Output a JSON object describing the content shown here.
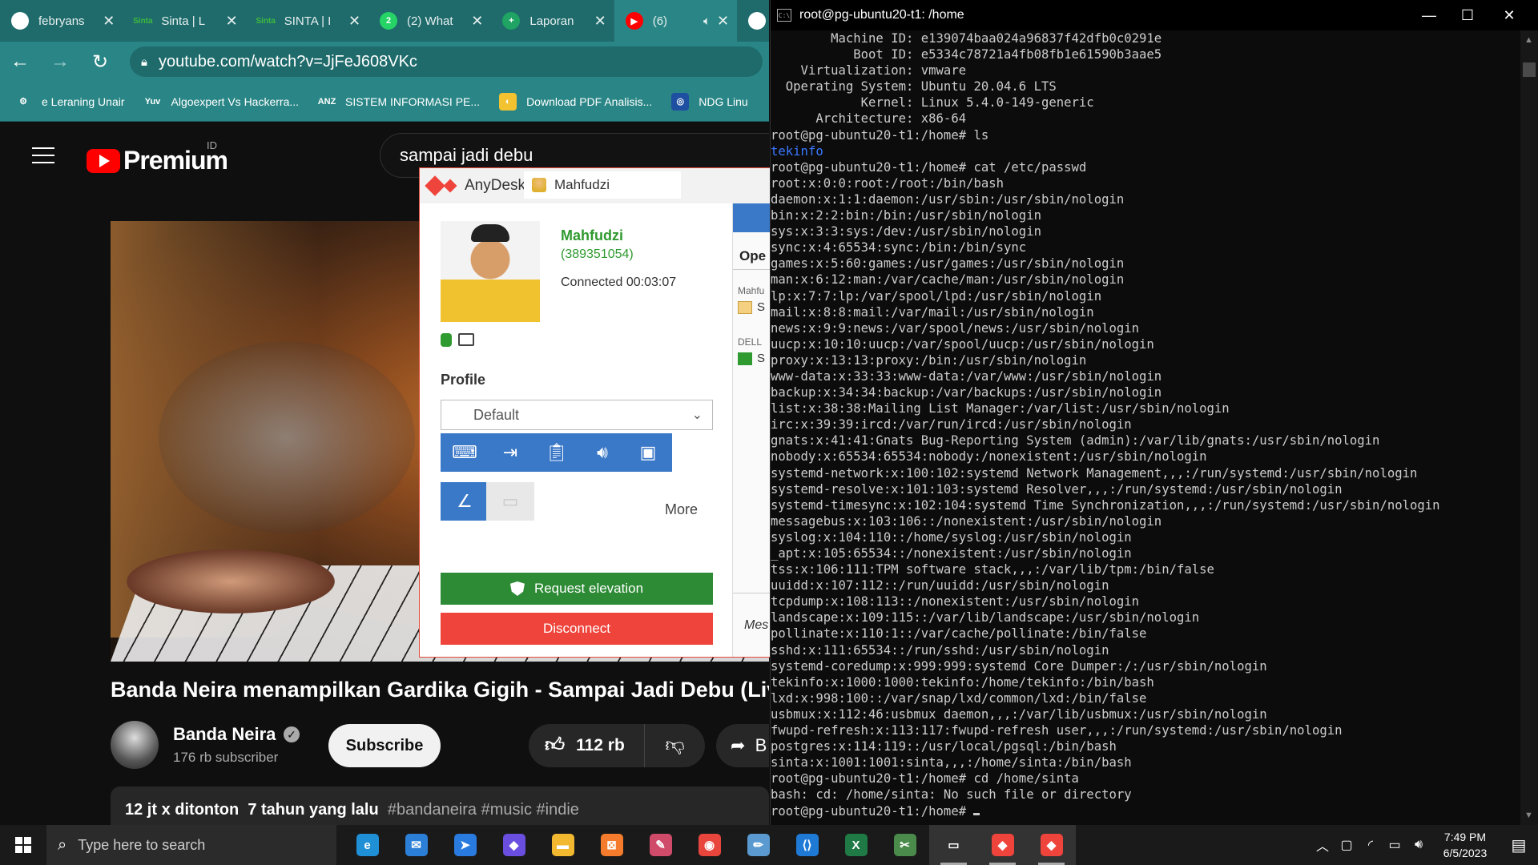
{
  "browser": {
    "tabs": [
      {
        "title": "febryans",
        "icon": "github-icon",
        "icon_text": "",
        "color": "#ffffff"
      },
      {
        "title": "Sinta | L",
        "icon": "sinta-icon",
        "icon_text": "Sinta",
        "color": "#3dbb3d"
      },
      {
        "title": "SINTA | I",
        "icon": "sinta-icon",
        "icon_text": "Sinta",
        "color": "#3dbb3d"
      },
      {
        "title": "(2) What",
        "icon": "whatsapp-icon",
        "icon_text": "2",
        "color": "#25d366"
      },
      {
        "title": "Laporan",
        "icon": "google-sheets-icon",
        "icon_text": "+",
        "color": "#1fa463"
      },
      {
        "title": "(6)",
        "icon": "youtube-icon",
        "icon_text": "▶",
        "color": "#ff0000"
      }
    ],
    "url": "youtube.com/watch?v=JjFeJ608VKc",
    "bookmarks": [
      {
        "label": "e Leraning Unair",
        "icon": "gear-icon",
        "icon_text": "⚙",
        "color": "#2a8686"
      },
      {
        "label": "Algoexpert Vs Hackerra...",
        "icon": "yuv-icon",
        "icon_text": "Yuv",
        "color": "#2a8686"
      },
      {
        "label": "SISTEM INFORMASI PE...",
        "icon": "anz-icon",
        "icon_text": "ANZ",
        "color": "#2a8686"
      },
      {
        "label": "Download PDF Analisis...",
        "icon": "pdf-icon",
        "icon_text": "◐",
        "color": "#f2c230"
      },
      {
        "label": "NDG Linu",
        "icon": "ndg-icon",
        "icon_text": "◎",
        "color": "#1e4fa0"
      }
    ]
  },
  "youtube": {
    "logo": "Premium",
    "country": "ID",
    "search_value": "sampai jadi debu",
    "title": "Banda Neira menampilkan Gardika Gigih - Sampai Jadi Debu (Live",
    "channel": "Banda Neira",
    "subscribers": "176 rb subscriber",
    "subscribe_label": "Subscribe",
    "likes": "112 rb",
    "share_label": "B",
    "views": "12 jt x ditonton",
    "age": "7 tahun yang lalu",
    "tags": "#bandaneira #music #indie"
  },
  "anydesk": {
    "app_name": "AnyDesk",
    "tab_name": "Mahfudzi",
    "user_name": "Mahfudzi",
    "user_id": "(389351054)",
    "connected": "Connected 00:03:07",
    "profile_label": "Profile",
    "profile_value": "Default",
    "tools": [
      "keyboard-mouse-icon",
      "file-transfer-icon",
      "clipboard-icon",
      "audio-icon",
      "record-icon",
      "draw-icon",
      "screen-lock-icon"
    ],
    "more_label": "More",
    "elevation_label": "Request elevation",
    "disconnect_label": "Disconnect",
    "side": {
      "open": "Ope",
      "sub1": "Mahfu",
      "item1": "S",
      "sub2": "DELL",
      "item2": "S",
      "mes": "Mes"
    }
  },
  "terminal": {
    "title": "root@pg-ubuntu20-t1: /home",
    "lines": [
      "        Machine ID: e139074baa024a96837f42dfb0c0291e",
      "           Boot ID: e5334c78721a4fb08fb1e61590b3aae5",
      "    Virtualization: vmware",
      "  Operating System: Ubuntu 20.04.6 LTS",
      "            Kernel: Linux 5.4.0-149-generic",
      "      Architecture: x86-64",
      "root@pg-ubuntu20-t1:/home# ls",
      "tekinfo",
      "root@pg-ubuntu20-t1:/home# cat /etc/passwd",
      "root:x:0:0:root:/root:/bin/bash",
      "daemon:x:1:1:daemon:/usr/sbin:/usr/sbin/nologin",
      "bin:x:2:2:bin:/bin:/usr/sbin/nologin",
      "sys:x:3:3:sys:/dev:/usr/sbin/nologin",
      "sync:x:4:65534:sync:/bin:/bin/sync",
      "games:x:5:60:games:/usr/games:/usr/sbin/nologin",
      "man:x:6:12:man:/var/cache/man:/usr/sbin/nologin",
      "lp:x:7:7:lp:/var/spool/lpd:/usr/sbin/nologin",
      "mail:x:8:8:mail:/var/mail:/usr/sbin/nologin",
      "news:x:9:9:news:/var/spool/news:/usr/sbin/nologin",
      "uucp:x:10:10:uucp:/var/spool/uucp:/usr/sbin/nologin",
      "proxy:x:13:13:proxy:/bin:/usr/sbin/nologin",
      "www-data:x:33:33:www-data:/var/www:/usr/sbin/nologin",
      "backup:x:34:34:backup:/var/backups:/usr/sbin/nologin",
      "list:x:38:38:Mailing List Manager:/var/list:/usr/sbin/nologin",
      "irc:x:39:39:ircd:/var/run/ircd:/usr/sbin/nologin",
      "gnats:x:41:41:Gnats Bug-Reporting System (admin):/var/lib/gnats:/usr/sbin/nologin",
      "nobody:x:65534:65534:nobody:/nonexistent:/usr/sbin/nologin",
      "systemd-network:x:100:102:systemd Network Management,,,:/run/systemd:/usr/sbin/nologin",
      "systemd-resolve:x:101:103:systemd Resolver,,,:/run/systemd:/usr/sbin/nologin",
      "systemd-timesync:x:102:104:systemd Time Synchronization,,,:/run/systemd:/usr/sbin/nologin",
      "messagebus:x:103:106::/nonexistent:/usr/sbin/nologin",
      "syslog:x:104:110::/home/syslog:/usr/sbin/nologin",
      "_apt:x:105:65534::/nonexistent:/usr/sbin/nologin",
      "tss:x:106:111:TPM software stack,,,:/var/lib/tpm:/bin/false",
      "uuidd:x:107:112::/run/uuidd:/usr/sbin/nologin",
      "tcpdump:x:108:113::/nonexistent:/usr/sbin/nologin",
      "landscape:x:109:115::/var/lib/landscape:/usr/sbin/nologin",
      "pollinate:x:110:1::/var/cache/pollinate:/bin/false",
      "sshd:x:111:65534::/run/sshd:/usr/sbin/nologin",
      "systemd-coredump:x:999:999:systemd Core Dumper:/:/usr/sbin/nologin",
      "tekinfo:x:1000:1000:tekinfo:/home/tekinfo:/bin/bash",
      "lxd:x:998:100::/var/snap/lxd/common/lxd:/bin/false",
      "usbmux:x:112:46:usbmux daemon,,,:/var/lib/usbmux:/usr/sbin/nologin",
      "fwupd-refresh:x:113:117:fwupd-refresh user,,,:/run/systemd:/usr/sbin/nologin",
      "postgres:x:114:119::/usr/local/pgsql:/bin/bash",
      "sinta:x:1001:1001:sinta,,,:/home/sinta:/bin/bash",
      "root@pg-ubuntu20-t1:/home# cd /home/sinta",
      "bash: cd: /home/sinta: No such file or directory",
      "root@pg-ubuntu20-t1:/home# "
    ],
    "highlight_line": 7
  },
  "taskbar": {
    "search_placeholder": "Type here to search",
    "apps": [
      {
        "name": "edge-icon",
        "glyph": "e",
        "color": "#1f8fd6"
      },
      {
        "name": "mail-icon",
        "glyph": "✉",
        "color": "#2c7fd6"
      },
      {
        "name": "arrow-app-icon",
        "glyph": "➤",
        "color": "#2a7be0"
      },
      {
        "name": "copilot-icon",
        "glyph": "◆",
        "color": "#6a4ee0"
      },
      {
        "name": "file-explorer-icon",
        "glyph": "▬",
        "color": "#f2b830"
      },
      {
        "name": "xampp-icon",
        "glyph": "⊠",
        "color": "#f57c2c"
      },
      {
        "name": "paint-icon",
        "glyph": "✎",
        "color": "#d04a6a"
      },
      {
        "name": "chrome-icon",
        "glyph": "◉",
        "color": "#e8453c"
      },
      {
        "name": "notepad-icon",
        "glyph": "✏",
        "color": "#5a9ad0"
      },
      {
        "name": "vscode-icon",
        "glyph": "⟨⟩",
        "color": "#1f7ad6"
      },
      {
        "name": "excel-icon",
        "glyph": "X",
        "color": "#1f7a45"
      },
      {
        "name": "snipping-icon",
        "glyph": "✂",
        "color": "#4a8a4a"
      },
      {
        "name": "terminal-icon",
        "glyph": "▭",
        "color": "#333333",
        "active": true
      },
      {
        "name": "anydesk-icon",
        "glyph": "◆",
        "color": "#ef443b",
        "active": true
      },
      {
        "name": "anydesk-icon",
        "glyph": "◆",
        "color": "#ef443b",
        "active": true
      }
    ],
    "time": "7:49 PM",
    "date": "6/5/2023"
  }
}
